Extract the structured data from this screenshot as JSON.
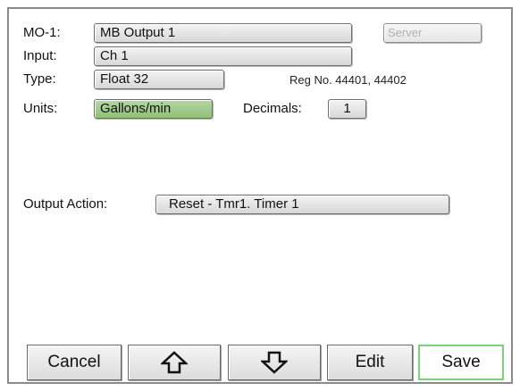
{
  "form": {
    "mo_label": "MO-1:",
    "mo_value": "MB Output 1",
    "server_label": "Server",
    "input_label": "Input:",
    "input_value": "Ch 1",
    "type_label": "Type:",
    "type_value": "Float 32",
    "reg_text": "Reg No. 44401, 44402",
    "units_label": "Units:",
    "units_value": "Gallons/min",
    "decimals_label": "Decimals:",
    "decimals_value": "1",
    "output_action_label": "Output Action:",
    "output_action_value": "Reset - Tmr1. Timer 1"
  },
  "buttons": {
    "cancel": "Cancel",
    "up_icon": "up-arrow-icon",
    "down_icon": "down-arrow-icon",
    "edit": "Edit",
    "save": "Save"
  },
  "colors": {
    "units_field": "#9fcb8a",
    "save_border": "#7cd27c"
  }
}
